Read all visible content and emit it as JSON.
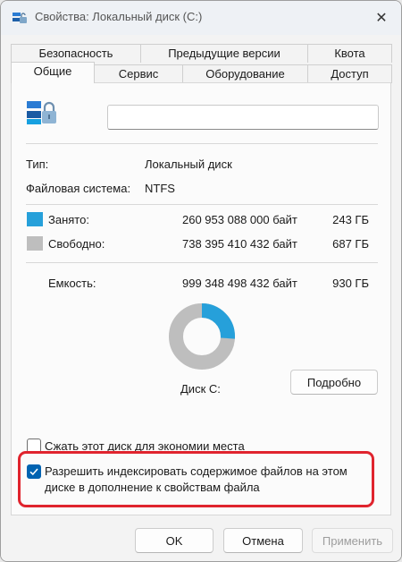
{
  "window": {
    "title": "Свойства: Локальный диск (C:)",
    "close_icon": "close-icon",
    "title_icon": "drive-properties-icon"
  },
  "tabs": {
    "row_back": [
      {
        "label": "Безопасность"
      },
      {
        "label": "Предыдущие версии"
      },
      {
        "label": "Квота"
      }
    ],
    "row_front": [
      {
        "label": "Общие",
        "active": true
      },
      {
        "label": "Сервис"
      },
      {
        "label": "Оборудование"
      },
      {
        "label": "Доступ"
      }
    ]
  },
  "general": {
    "drive_icon": "drive-lock-icon",
    "name_value": "",
    "type_label": "Тип:",
    "type_value": "Локальный диск",
    "fs_label": "Файловая система:",
    "fs_value": "NTFS",
    "used_label": "Занято:",
    "used_bytes": "260 953 088 000 байт",
    "used_gb": "243 ГБ",
    "used_color": "#26a0da",
    "free_label": "Свободно:",
    "free_bytes": "738 395 410 432 байт",
    "free_gb": "687 ГБ",
    "free_color": "#bebebe",
    "capacity_label": "Емкость:",
    "capacity_bytes": "999 348 498 432 байт",
    "capacity_gb": "930 ГБ",
    "used_fraction": 0.261,
    "disk_label": "Диск C:",
    "details_button": "Подробно",
    "compress_label": "Сжать этот диск для экономии места",
    "compress_checked": false,
    "index_label_line1": "Разрешить индексировать содержимое файлов на этом",
    "index_label_line2": "диске в дополнение к свойствам файла",
    "index_checked": true
  },
  "footer": {
    "ok": "OK",
    "cancel": "Отмена",
    "apply": "Применить"
  },
  "colors": {
    "accent": "#0063b1",
    "highlight": "#e0242e"
  }
}
